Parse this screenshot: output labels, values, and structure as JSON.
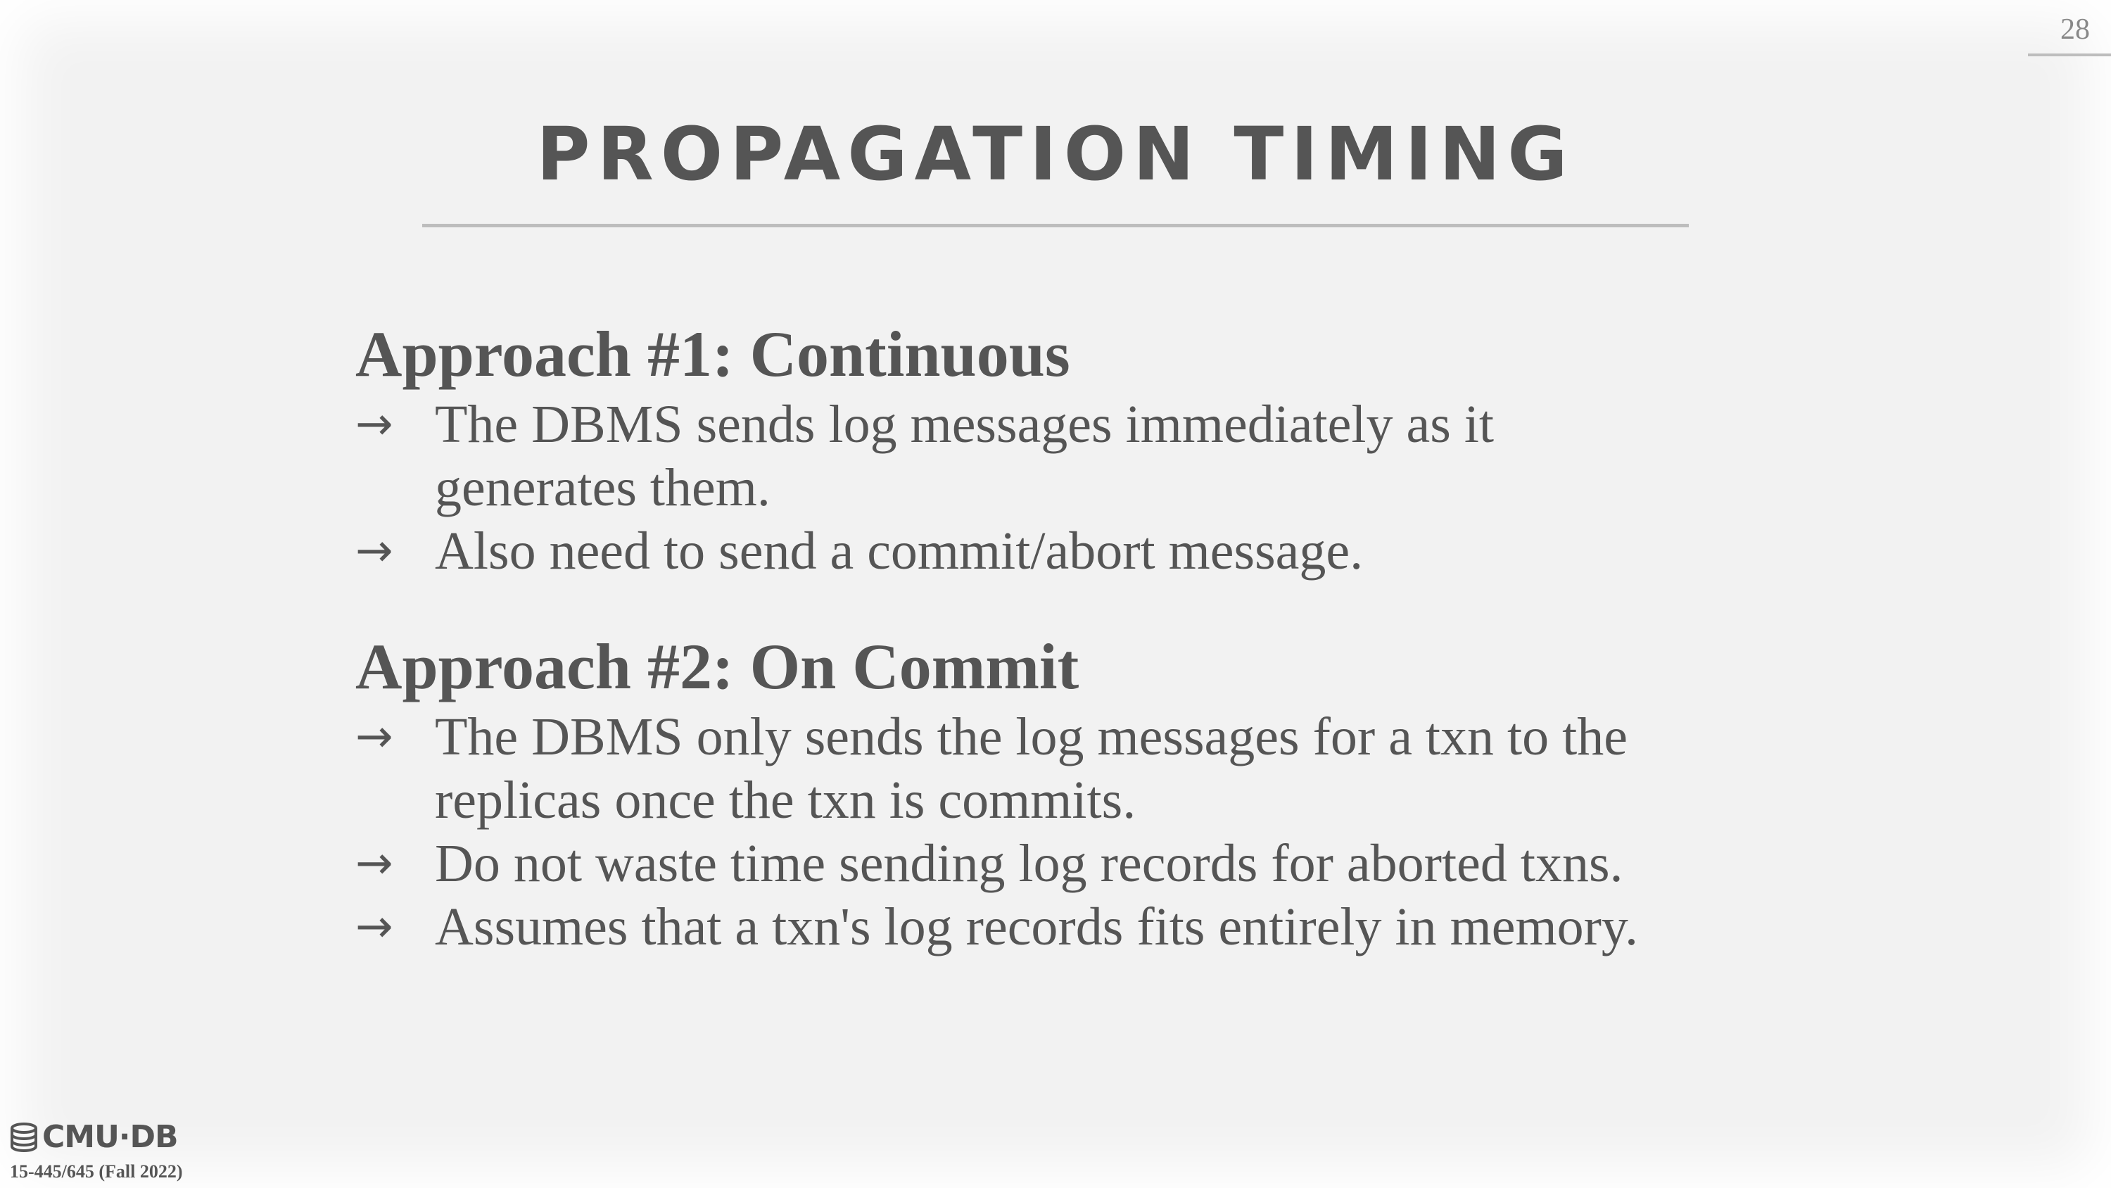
{
  "page_number": "28",
  "title": "PROPAGATION TIMING",
  "sections": [
    {
      "heading": "Approach #1: Continuous",
      "bullets": [
        [
          "The DBMS sends log messages immediately as it",
          "generates them."
        ],
        [
          "Also need to send a commit/abort message."
        ]
      ]
    },
    {
      "heading": "Approach #2: On Commit",
      "bullets": [
        [
          "The DBMS only sends the log messages for a txn to the",
          "replicas once the txn is commits."
        ],
        [
          "Do not waste time sending log records for aborted txns."
        ],
        [
          "Assumes that a txn's log records fits entirely in memory."
        ]
      ]
    }
  ],
  "bullet_arrow": "→",
  "footer": {
    "logo_text": "CMU·DB",
    "logo_icon": "database-stack-icon",
    "course": "15-445/645 (Fall 2022)"
  }
}
